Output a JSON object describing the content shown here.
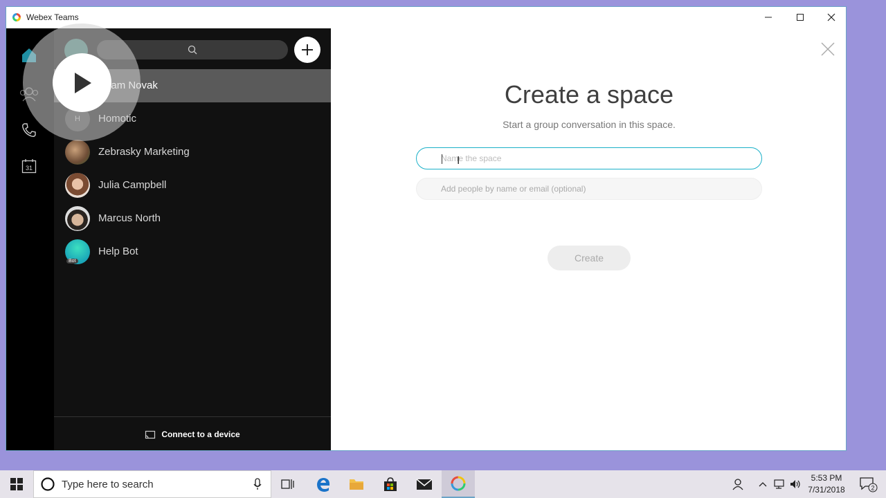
{
  "window": {
    "title": "Webex Teams"
  },
  "rail": {
    "items": [
      {
        "name": "home-icon"
      },
      {
        "name": "teams-icon"
      },
      {
        "name": "phone-icon"
      },
      {
        "name": "calendar-icon",
        "label": "31"
      }
    ]
  },
  "spacelist": {
    "items": [
      {
        "label": "Adam Novak",
        "selected": true
      },
      {
        "label": "Homotic",
        "initial": "H"
      },
      {
        "label": "Zebrasky Marketing"
      },
      {
        "label": "Julia Campbell"
      },
      {
        "label": "Marcus North"
      },
      {
        "label": "Help Bot",
        "badge": "Bot"
      }
    ],
    "footer_label": "Connect to a device"
  },
  "main": {
    "heading": "Create a space",
    "subheading": "Start a group conversation in this space.",
    "name_placeholder": "Name the space",
    "people_placeholder": "Add people by name or email (optional)",
    "create_label": "Create"
  },
  "taskbar": {
    "search_placeholder": "Type here to search",
    "time": "5:53 PM",
    "date": "7/31/2018",
    "notification_count": "2"
  },
  "colors": {
    "accent": "#1ab0c8",
    "rail_bg": "#000000",
    "list_bg": "#111111",
    "desktop_bg": "#9a93db"
  }
}
